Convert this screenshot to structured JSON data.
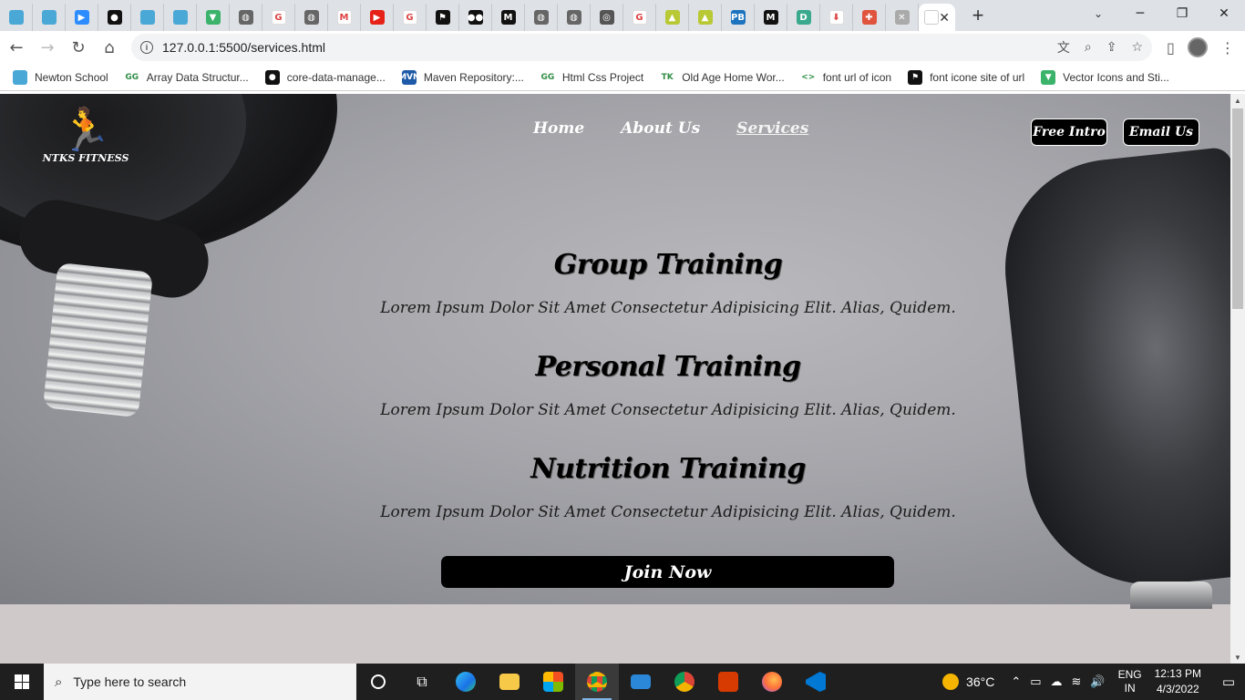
{
  "browser": {
    "tabs": [
      {
        "icon": "newton-school-icon",
        "color": "#4aa8d6",
        "glyph": ""
      },
      {
        "icon": "newton-school-icon",
        "color": "#4aa8d6",
        "glyph": ""
      },
      {
        "icon": "zoom-icon",
        "color": "#2d8cff",
        "glyph": "▶"
      },
      {
        "icon": "github-icon",
        "color": "#111111",
        "glyph": "●"
      },
      {
        "icon": "newton-school-icon",
        "color": "#4aa8d6",
        "glyph": ""
      },
      {
        "icon": "newton-school-icon",
        "color": "#4aa8d6",
        "glyph": ""
      },
      {
        "icon": "vector-icon",
        "color": "#3bb36b",
        "glyph": "▼"
      },
      {
        "icon": "globe-icon",
        "color": "#666666",
        "glyph": "◍"
      },
      {
        "icon": "google-icon",
        "color": "#ffffff",
        "glyph": "G"
      },
      {
        "icon": "globe-icon",
        "color": "#666666",
        "glyph": "◍"
      },
      {
        "icon": "gmail-icon",
        "color": "#ffffff",
        "glyph": "M"
      },
      {
        "icon": "youtube-icon",
        "color": "#e62117",
        "glyph": "▶"
      },
      {
        "icon": "google-icon",
        "color": "#ffffff",
        "glyph": "G"
      },
      {
        "icon": "flag-icon",
        "color": "#111111",
        "glyph": "⚑"
      },
      {
        "icon": "medium-icon",
        "color": "#111111",
        "glyph": "●●"
      },
      {
        "icon": "medium-icon",
        "color": "#111111",
        "glyph": "M"
      },
      {
        "icon": "globe-icon",
        "color": "#666666",
        "glyph": "◍"
      },
      {
        "icon": "globe-icon",
        "color": "#666666",
        "glyph": "◍"
      },
      {
        "icon": "chrome-icon",
        "color": "#555555",
        "glyph": "◎"
      },
      {
        "icon": "google-icon",
        "color": "#ffffff",
        "glyph": "G"
      },
      {
        "icon": "image-icon",
        "color": "#b8c935",
        "glyph": "▲"
      },
      {
        "icon": "image-icon",
        "color": "#b8c935",
        "glyph": "▲"
      },
      {
        "icon": "pb-icon",
        "color": "#1e73be",
        "glyph": "PB"
      },
      {
        "icon": "medium-icon",
        "color": "#111111",
        "glyph": "M"
      },
      {
        "icon": "d-icon",
        "color": "#3aa98d",
        "glyph": "D"
      },
      {
        "icon": "download-icon",
        "color": "#ffffff",
        "glyph": "⬇"
      },
      {
        "icon": "puzzle-icon",
        "color": "#e0533c",
        "glyph": "✚"
      },
      {
        "icon": "pattern-icon",
        "color": "#aaaaaa",
        "glyph": "✕"
      }
    ],
    "url": "127.0.0.1:5500/services.html",
    "bookmarks": [
      {
        "label": "Newton School",
        "icon": "newton-school-icon",
        "color": "#4aa8d6",
        "glyph": ""
      },
      {
        "label": "Array Data Structur...",
        "icon": "gfg-icon",
        "color": "#ffffff",
        "glyph": "GG"
      },
      {
        "label": "core-data-manage...",
        "icon": "github-icon",
        "color": "#111111",
        "glyph": "●"
      },
      {
        "label": "Maven Repository:...",
        "icon": "maven-icon",
        "color": "#1e5aa8",
        "glyph": "MVN"
      },
      {
        "label": "Html Css Project",
        "icon": "gfg-icon",
        "color": "#ffffff",
        "glyph": "GG"
      },
      {
        "label": "Old Age Home Wor...",
        "icon": "tk-icon",
        "color": "#ffffff",
        "glyph": "TK"
      },
      {
        "label": "font url of icon",
        "icon": "code-icon",
        "color": "#ffffff",
        "glyph": "<>"
      },
      {
        "label": "font icone site of url",
        "icon": "flag-icon",
        "color": "#111111",
        "glyph": "⚑"
      },
      {
        "label": "Vector Icons and Sti...",
        "icon": "vector-icon",
        "color": "#3bb36b",
        "glyph": "▼"
      }
    ]
  },
  "site": {
    "logo_text": "NTKS FITNESS",
    "nav": [
      "Home",
      "About Us",
      "Services"
    ],
    "buttons": {
      "free_intro": "Free Intro",
      "email_us": "Email Us",
      "join_now": "Join Now"
    },
    "services": [
      {
        "title": "Group Training",
        "text": "Lorem Ipsum Dolor Sit Amet Consectetur Adipisicing Elit. Alias, Quidem."
      },
      {
        "title": "Personal Training",
        "text": "Lorem Ipsum Dolor Sit Amet Consectetur Adipisicing Elit. Alias, Quidem."
      },
      {
        "title": "Nutrition Training",
        "text": "Lorem Ipsum Dolor Sit Amet Consectetur Adipisicing Elit. Alias, Quidem."
      }
    ]
  },
  "taskbar": {
    "search_placeholder": "Type here to search",
    "weather": "36°C",
    "lang": "ENG",
    "region": "IN",
    "time": "12:13 PM",
    "date": "4/3/2022"
  }
}
